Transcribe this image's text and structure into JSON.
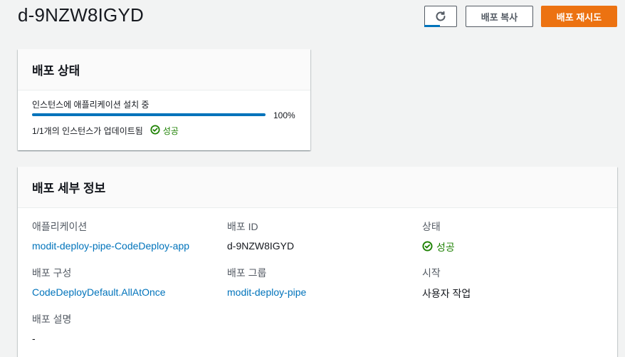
{
  "page": {
    "title": "d-9NZW8IGYD"
  },
  "toolbar": {
    "refresh_icon": "refresh-icon",
    "copy_label": "배포 복사",
    "retry_label": "배포 재시도",
    "accent_color": "#ec7211"
  },
  "deploy_status": {
    "title": "배포 상태",
    "progress_label": "인스턴스에 애플리케이션 설치 중",
    "progress_percent": 100,
    "progress_text": "100%",
    "updated_text": "1/1개의 인스턴스가 업데이트됨",
    "result_label": "성공",
    "result_icon": "check-circle-icon",
    "result_color": "#1d8102"
  },
  "deploy_details": {
    "title": "배포 세부 정보",
    "fields": {
      "application": {
        "label": "애플리케이션",
        "value": "modit-deploy-pipe-CodeDeploy-app"
      },
      "deployment_id": {
        "label": "배포 ID",
        "value": "d-9NZW8IGYD"
      },
      "status": {
        "label": "상태",
        "value": "성공"
      },
      "config": {
        "label": "배포 구성",
        "value": "CodeDeployDefault.AllAtOnce"
      },
      "group": {
        "label": "배포 그룹",
        "value": "modit-deploy-pipe"
      },
      "start": {
        "label": "시작",
        "value": "사용자 작업"
      },
      "description": {
        "label": "배포 설명",
        "value": "-"
      }
    }
  }
}
